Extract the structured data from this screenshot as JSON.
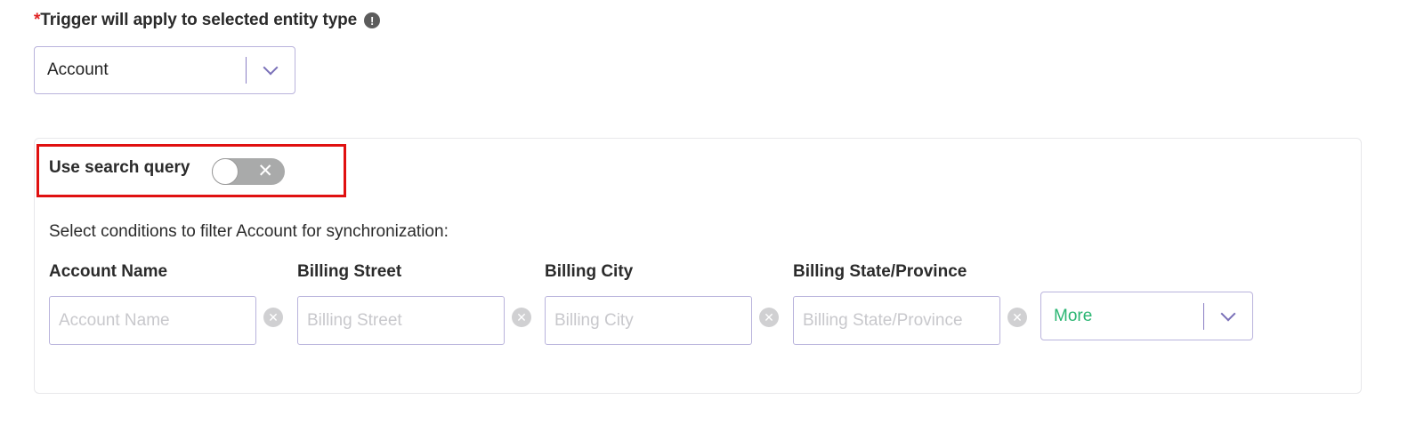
{
  "trigger": {
    "required_mark": "*",
    "label": "Trigger will apply to selected entity type",
    "info_icon": "!",
    "entity_select": {
      "value": "Account"
    }
  },
  "search_query": {
    "label": "Use search query",
    "toggle_state": "off",
    "toggle_glyph": "✕"
  },
  "filter": {
    "description": "Select conditions to filter Account for synchronization:",
    "fields": [
      {
        "label": "Account Name",
        "placeholder": "Account Name"
      },
      {
        "label": "Billing Street",
        "placeholder": "Billing Street"
      },
      {
        "label": "Billing City",
        "placeholder": "Billing City"
      },
      {
        "label": "Billing State/Province",
        "placeholder": "Billing State/Province"
      }
    ],
    "clear_glyph": "✕",
    "more_select": {
      "value": "More"
    }
  },
  "colors": {
    "accent_border": "#b9b3dc",
    "chevron": "#7a70b8",
    "more_text": "#2bb673",
    "highlight": "#e01010",
    "required": "#e02424"
  },
  "icons": [
    "info-icon",
    "chevron-down-icon",
    "close-icon",
    "clear-icon"
  ]
}
